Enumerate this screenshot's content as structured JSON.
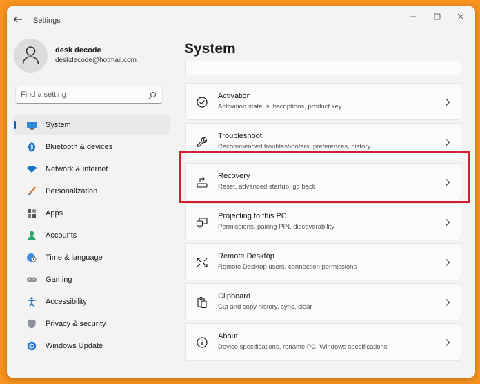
{
  "window": {
    "title": "Settings"
  },
  "profile": {
    "name": "desk decode",
    "email": "deskdecode@hotmail.com"
  },
  "search": {
    "placeholder": "Find a setting"
  },
  "nav": {
    "items": [
      {
        "label": "System",
        "icon": "system-icon",
        "active": true
      },
      {
        "label": "Bluetooth & devices",
        "icon": "bluetooth-icon"
      },
      {
        "label": "Network & internet",
        "icon": "wifi-icon"
      },
      {
        "label": "Personalization",
        "icon": "brush-icon"
      },
      {
        "label": "Apps",
        "icon": "apps-icon"
      },
      {
        "label": "Accounts",
        "icon": "account-icon"
      },
      {
        "label": "Time & language",
        "icon": "globe-clock-icon"
      },
      {
        "label": "Gaming",
        "icon": "gamepad-icon"
      },
      {
        "label": "Accessibility",
        "icon": "accessibility-icon"
      },
      {
        "label": "Privacy & security",
        "icon": "shield-icon"
      },
      {
        "label": "Windows Update",
        "icon": "update-icon"
      }
    ]
  },
  "main": {
    "title": "System",
    "cards": [
      {
        "title": "Activation",
        "desc": "Activation state, subscriptions, product key",
        "icon": "check-circle-icon"
      },
      {
        "title": "Troubleshoot",
        "desc": "Recommended troubleshooters, preferences, history",
        "icon": "wrench-icon"
      },
      {
        "title": "Recovery",
        "desc": "Reset, advanced startup, go back",
        "icon": "recovery-icon",
        "highlighted": true
      },
      {
        "title": "Projecting to this PC",
        "desc": "Permissions, pairing PIN, discoverability",
        "icon": "projecting-icon"
      },
      {
        "title": "Remote Desktop",
        "desc": "Remote Desktop users, connection permissions",
        "icon": "remote-desktop-icon"
      },
      {
        "title": "Clipboard",
        "desc": "Cut and copy history, sync, clear",
        "icon": "clipboard-icon"
      },
      {
        "title": "About",
        "desc": "Device specifications, rename PC, Windows specifications",
        "icon": "info-icon"
      }
    ]
  },
  "colors": {
    "accent": "#005fb8",
    "highlight": "#d0202e",
    "background": "#f7931e"
  }
}
